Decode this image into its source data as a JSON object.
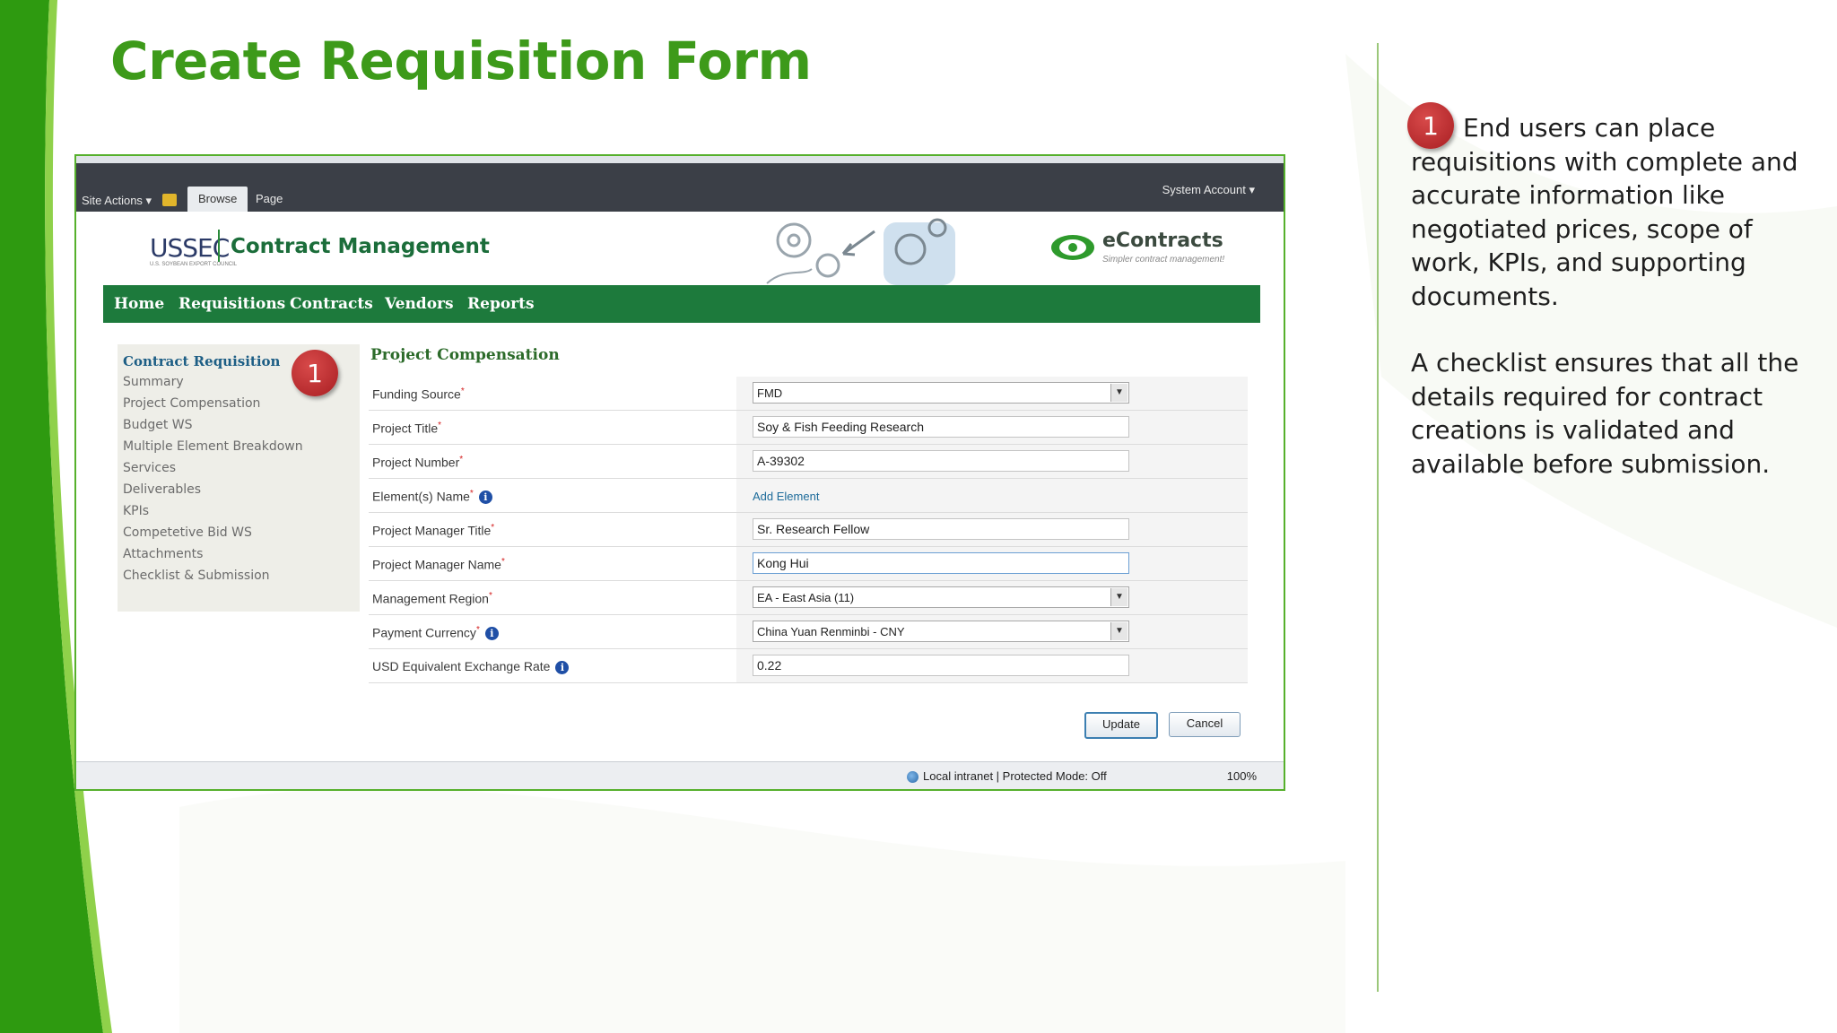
{
  "slide": {
    "title": "Create Requisition Form",
    "badge_number": "1",
    "note_paragraph_1": "End users can place requisitions with complete and accurate information like negotiated prices, scope of work, KPIs, and supporting documents.",
    "note_paragraph_2": "A checklist ensures that all the details required for contract creations is validated and available before submission."
  },
  "ribbon": {
    "site_actions": "Site Actions ▾",
    "tab_browse": "Browse",
    "tab_page": "Page",
    "system_account": "System Account ▾"
  },
  "brand": {
    "org_logo": "USSEC",
    "org_logo_sub": "U.S. SOYBEAN EXPORT COUNCIL",
    "app_title": "Contract Management",
    "product_name": "eContracts",
    "product_tagline": "Simpler contract management!"
  },
  "nav": {
    "items": [
      "Home",
      "Requisitions",
      "Contracts",
      "Vendors",
      "Reports"
    ]
  },
  "left_panel": {
    "title": "Contract Requisition",
    "items": [
      "Summary",
      "Project Compensation",
      "Budget WS",
      "Multiple Element Breakdown",
      "Services",
      "Deliverables",
      "KPIs",
      "Competetive Bid WS",
      "Attachments",
      "Checklist & Submission"
    ]
  },
  "form": {
    "title": "Project Compensation",
    "funding_source": {
      "label": "Funding Source",
      "value": "FMD"
    },
    "project_title": {
      "label": "Project Title",
      "value": "Soy & Fish Feeding Research"
    },
    "project_number": {
      "label": "Project Number",
      "value": "A-39302"
    },
    "element_name": {
      "label": "Element(s) Name",
      "link": "Add Element"
    },
    "pm_title": {
      "label": "Project Manager Title",
      "value": "Sr. Research Fellow"
    },
    "pm_name": {
      "label": "Project Manager Name",
      "value": "Kong Hui"
    },
    "region": {
      "label": "Management Region",
      "value": "EA - East Asia (11)"
    },
    "currency": {
      "label": "Payment Currency",
      "value": "China Yuan Renminbi - CNY"
    },
    "exchange_rate": {
      "label": "USD Equivalent Exchange Rate",
      "value": "0.22"
    },
    "update_button": "Update",
    "cancel_button": "Cancel",
    "required_mark": "*",
    "info_glyph": "i"
  },
  "statusbar": {
    "zone": "Local intranet | Protected Mode: Off",
    "zoom": "100%"
  },
  "colors": {
    "title_green": "#3d9a1a",
    "nav_green": "#1d7a3c",
    "badge_red": "#b52a2e"
  }
}
